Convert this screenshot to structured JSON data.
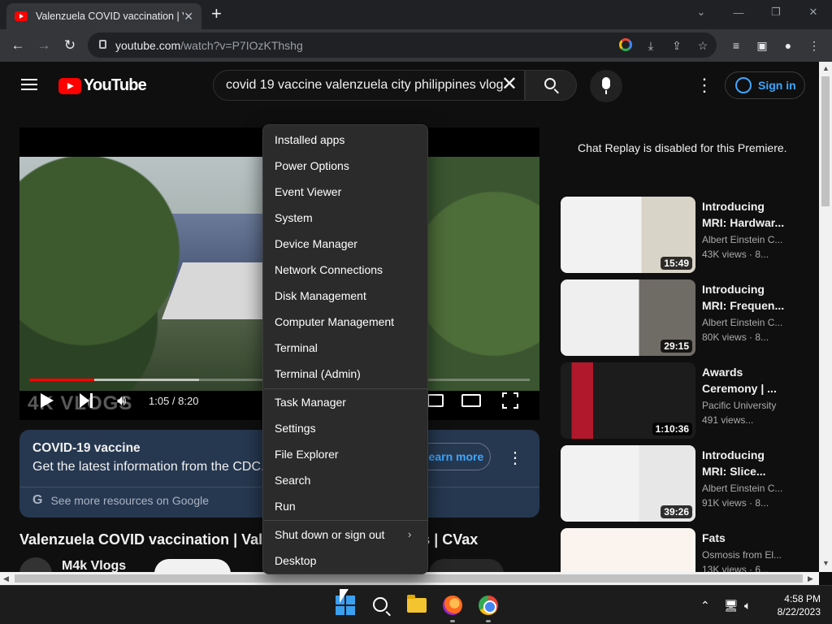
{
  "browser": {
    "tab_title": "Valenzuela COVID vaccination | V",
    "tab_close": "✕",
    "new_tab": "+",
    "url_host": "youtube.com",
    "url_path": "/watch?v=P7IOzKThshg"
  },
  "youtube": {
    "logo_text": "YouTube",
    "search_query": "covid 19 vaccine valenzuela city philippines vlog",
    "sign_in": "Sign in",
    "player": {
      "time": "1:05 / 8:20",
      "watermark": "4K VLOGS",
      "progress_fraction": 0.13,
      "buffered_fraction": 0.34
    },
    "info_card": {
      "title": "COVID-19 vaccine",
      "subtitle": "Get the latest information from the CDC.",
      "learn_more": "Learn more",
      "footer": "See more resources on Google"
    },
    "video_title": "Valenzuela COVID vaccination | Valenzuela City Philippines | CVax",
    "channel_name": "M4k Vlogs",
    "chat_note": "Chat Replay is disabled for this Premiere.",
    "recommendations": [
      {
        "title": "Introducing MRI: Hardwar...",
        "channel": "Albert Einstein C...",
        "meta": "43K views · 8...",
        "duration": "15:49"
      },
      {
        "title": "Introducing MRI: Frequen...",
        "channel": "Albert Einstein C...",
        "meta": "80K views · 8...",
        "duration": "29:15"
      },
      {
        "title": "Awards Ceremony | ...",
        "channel": "Pacific University",
        "meta": "491 views...",
        "duration": "1:10:36"
      },
      {
        "title": "Introducing MRI: Slice...",
        "channel": "Albert Einstein C...",
        "meta": "91K views · 8...",
        "duration": "39:26"
      },
      {
        "title": "Fats",
        "channel": "Osmosis from El...",
        "meta": "13K views · 6...",
        "duration": ""
      }
    ]
  },
  "context_menu": {
    "items": [
      "Installed apps",
      "Power Options",
      "Event Viewer",
      "System",
      "Device Manager",
      "Network Connections",
      "Disk Management",
      "Computer Management",
      "Terminal",
      "Terminal (Admin)",
      "Task Manager",
      "Settings",
      "File Explorer",
      "Search",
      "Run",
      "Shut down or sign out",
      "Desktop"
    ]
  },
  "taskbar": {
    "time": "4:58 PM",
    "date": "8/22/2023"
  },
  "icons": [
    "windows-start-icon",
    "taskbar-search-icon",
    "file-explorer-icon",
    "firefox-icon",
    "chrome-icon"
  ]
}
